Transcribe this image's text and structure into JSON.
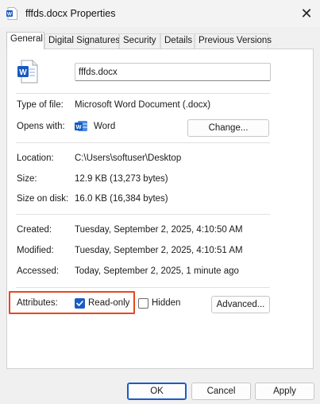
{
  "window": {
    "title": "fffds.docx Properties",
    "close_glyph": "✕"
  },
  "tabs": [
    {
      "label": "General",
      "active": true
    },
    {
      "label": "Digital Signatures",
      "active": false
    },
    {
      "label": "Security",
      "active": false
    },
    {
      "label": "Details",
      "active": false
    },
    {
      "label": "Previous Versions",
      "active": false
    }
  ],
  "general": {
    "filename": "fffds.docx",
    "type_label": "Type of file:",
    "type_value": "Microsoft Word Document (.docx)",
    "opens_label": "Opens with:",
    "opens_value": "Word",
    "change_button": "Change...",
    "location_label": "Location:",
    "location_value": "C:\\Users\\softuser\\Desktop",
    "size_label": "Size:",
    "size_value": "12.9 KB (13,273 bytes)",
    "size_disk_label": "Size on disk:",
    "size_disk_value": "16.0 KB (16,384 bytes)",
    "created_label": "Created:",
    "created_value": "Tuesday, September 2, 2025, 4:10:50 AM",
    "modified_label": "Modified:",
    "modified_value": "Tuesday, September 2, 2025, 4:10:51 AM",
    "accessed_label": "Accessed:",
    "accessed_value": "Today, September 2, 2025, 1 minute ago",
    "attributes_label": "Attributes:",
    "readonly_label": "Read-only",
    "readonly_checked": true,
    "hidden_label": "Hidden",
    "hidden_checked": false,
    "advanced_button": "Advanced..."
  },
  "footer": {
    "ok": "OK",
    "cancel": "Cancel",
    "apply": "Apply"
  },
  "colors": {
    "accent": "#1a5cc2",
    "highlight": "#e8471f",
    "word_blue": "#185abd"
  },
  "icons": {
    "title": "word-doc-icon",
    "file": "word-doc-icon",
    "opens_with": "word-app-icon",
    "checkmark": "checkmark-icon",
    "close": "close-icon"
  }
}
